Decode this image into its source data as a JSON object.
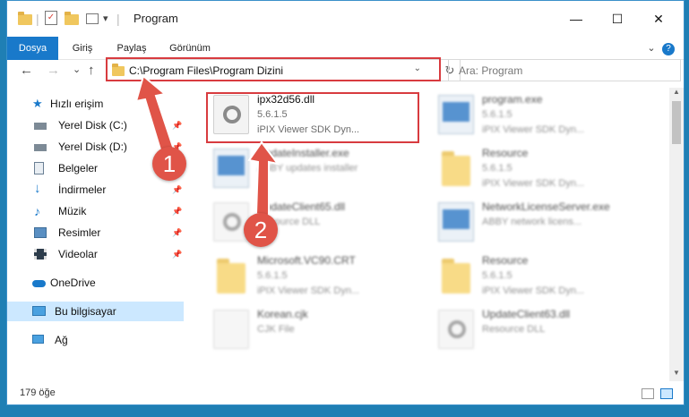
{
  "window": {
    "title": "Program",
    "min_glyph": "—",
    "max_glyph": "☐",
    "close_glyph": "✕"
  },
  "quick_access": {
    "checklist_icon": "✓",
    "dropdown": "▾"
  },
  "ribbon": {
    "tabs": [
      "Dosya",
      "Giriş",
      "Paylaş",
      "Görünüm"
    ],
    "expand": "⌄",
    "help": "?"
  },
  "nav": {
    "back": "←",
    "forward": "→",
    "recent": "⌄",
    "up": "↑"
  },
  "address": {
    "path": "C:\\Program Files\\Program Dizini",
    "dropdown": "⌄",
    "refresh": "↻"
  },
  "search": {
    "placeholder": "Ara: Program"
  },
  "sidebar": {
    "quick_access": "Hızlı erişim",
    "items": [
      {
        "label": "Yerel Disk (C:)",
        "pinned": true
      },
      {
        "label": "Yerel Disk (D:)",
        "pinned": true
      },
      {
        "label": "Belgeler",
        "pinned": true
      },
      {
        "label": "İndirmeler",
        "pinned": true
      },
      {
        "label": "Müzik",
        "pinned": true
      },
      {
        "label": "Resimler",
        "pinned": true
      },
      {
        "label": "Videolar",
        "pinned": true
      }
    ],
    "onedrive": "OneDrive",
    "this_pc": "Bu bilgisayar",
    "network": "Ağ",
    "pin_glyph": "📌"
  },
  "files": [
    {
      "name": "ipx32d56.dll",
      "line2": "5.6.1.5",
      "line3": "iPIX Viewer SDK Dyn...",
      "kind": "dll",
      "highlight": true
    },
    {
      "name": "program.exe",
      "line2": "5.6.1.5",
      "line3": "iPIX Viewer SDK Dyn...",
      "kind": "exe"
    },
    {
      "name": "UpdateInstaller.exe",
      "line2": "ABBY updates installer",
      "line3": "",
      "kind": "exe"
    },
    {
      "name": "Resource",
      "line2": "5.6.1.5",
      "line3": "iPIX Viewer SDK Dyn...",
      "kind": "folder"
    },
    {
      "name": "UpdateClient65.dll",
      "line2": "Resource DLL",
      "line3": "",
      "kind": "dll"
    },
    {
      "name": "NetworkLicenseServer.exe",
      "line2": "ABBY network licens...",
      "line3": "",
      "kind": "exe"
    },
    {
      "name": "Microsoft.VC90.CRT",
      "line2": "5.6.1.5",
      "line3": "iPIX Viewer SDK Dyn...",
      "kind": "folder"
    },
    {
      "name": "Resource",
      "line2": "5.6.1.5",
      "line3": "iPIX Viewer SDK Dyn...",
      "kind": "folder"
    },
    {
      "name": "Korean.cjk",
      "line2": "CJK File",
      "line3": "",
      "kind": "dll"
    },
    {
      "name": "UpdateClient63.dll",
      "line2": "Resource DLL",
      "line3": "",
      "kind": "dll"
    }
  ],
  "callouts": [
    "1",
    "2"
  ],
  "status": {
    "count": "179 öğe"
  },
  "colors": {
    "accent": "#1979ca",
    "highlight_box": "#d83b3f",
    "callout": "#e05448",
    "selection": "#cce8ff"
  }
}
